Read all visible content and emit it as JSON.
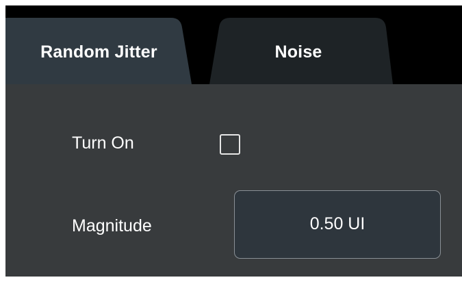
{
  "tabs": [
    {
      "label": "Random Jitter",
      "active": true
    },
    {
      "label": "Noise",
      "active": false
    }
  ],
  "settings": {
    "turn_on": {
      "label": "Turn On",
      "checked": false
    },
    "magnitude": {
      "label": "Magnitude",
      "value": "0.50 UI"
    }
  },
  "colors": {
    "frame_bg": "#000000",
    "active_tab": "#303a42",
    "inactive_tab": "#1e2326",
    "panel_bg": "#383b3d",
    "field_bg": "#2e363d",
    "field_border": "#8a9096",
    "text": "#ffffff"
  }
}
